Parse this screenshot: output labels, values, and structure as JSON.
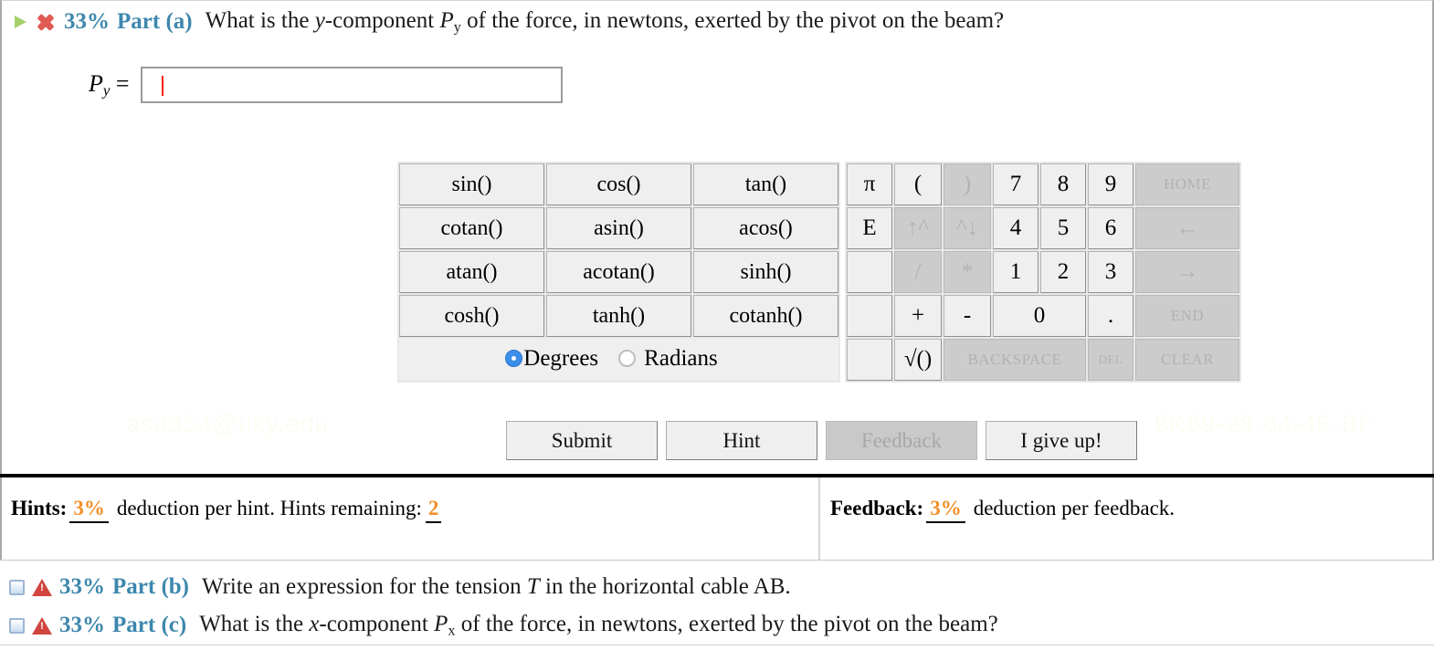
{
  "part_a": {
    "percent": "33%",
    "label": "Part (a)",
    "question_pre": "What is the ",
    "question_var": "y",
    "question_mid": "-component ",
    "question_sym": "P",
    "question_sub": "y",
    "question_post": " of the force, in newtons, exerted by the pivot on the beam?",
    "status_icon": "red-x-icon",
    "expand_icon": "green-triangle-icon"
  },
  "answer": {
    "label_sym": "P",
    "label_sub": "y",
    "label_eq": " = ",
    "value": "",
    "placeholder": ""
  },
  "calculator": {
    "function_rows": [
      [
        "sin()",
        "cos()",
        "tan()"
      ],
      [
        "cotan()",
        "asin()",
        "acos()"
      ],
      [
        "atan()",
        "acotan()",
        "sinh()"
      ],
      [
        "cosh()",
        "tanh()",
        "cotanh()"
      ]
    ],
    "mode": {
      "degrees_label": "Degrees",
      "radians_label": "Radians",
      "selected": "Degrees"
    },
    "keypad_rows": [
      [
        {
          "label": "π",
          "state": "enabled",
          "style": "pi"
        },
        {
          "label": "(",
          "state": "enabled",
          "style": "op"
        },
        {
          "label": ")",
          "state": "disabled",
          "style": "op"
        },
        {
          "label": "7",
          "state": "enabled",
          "style": "num"
        },
        {
          "label": "8",
          "state": "enabled",
          "style": "num"
        },
        {
          "label": "9",
          "state": "enabled",
          "style": "num"
        },
        {
          "label": "HOME",
          "state": "disabled",
          "style": "side-caps"
        }
      ],
      [
        {
          "label": "E",
          "state": "enabled",
          "style": "pi"
        },
        {
          "label": "↑^",
          "state": "disabled",
          "style": "op-arrow"
        },
        {
          "label": "^↓",
          "state": "disabled",
          "style": "op-arrow"
        },
        {
          "label": "4",
          "state": "enabled",
          "style": "num"
        },
        {
          "label": "5",
          "state": "enabled",
          "style": "num"
        },
        {
          "label": "6",
          "state": "enabled",
          "style": "num"
        },
        {
          "label": "←",
          "state": "disabled",
          "style": "side-arrow"
        }
      ],
      [
        {
          "label": "",
          "state": "blank",
          "style": "pi"
        },
        {
          "label": "/",
          "state": "disabled",
          "style": "op"
        },
        {
          "label": "*",
          "state": "disabled",
          "style": "op"
        },
        {
          "label": "1",
          "state": "enabled",
          "style": "num"
        },
        {
          "label": "2",
          "state": "enabled",
          "style": "num"
        },
        {
          "label": "3",
          "state": "enabled",
          "style": "num"
        },
        {
          "label": "→",
          "state": "disabled",
          "style": "side-arrow"
        }
      ],
      [
        {
          "label": "",
          "state": "blank",
          "style": "pi"
        },
        {
          "label": "+",
          "state": "enabled",
          "style": "op"
        },
        {
          "label": "-",
          "state": "enabled",
          "style": "op"
        },
        {
          "label": "0",
          "state": "enabled",
          "style": "num2"
        },
        {
          "label": ".",
          "state": "enabled",
          "style": "num"
        },
        {
          "label": "END",
          "state": "disabled",
          "style": "side-caps"
        }
      ],
      [
        {
          "label": "",
          "state": "blank",
          "style": "pi"
        },
        {
          "label": "√()",
          "state": "enabled",
          "style": "op"
        },
        {
          "label": "BACKSPACE",
          "state": "disabled",
          "style": "span3-caps"
        },
        {
          "label": "DEL",
          "state": "disabled",
          "style": "tiny-caps"
        },
        {
          "label": "CLEAR",
          "state": "disabled",
          "style": "side-caps"
        }
      ]
    ]
  },
  "actions": {
    "submit": "Submit",
    "hint": "Hint",
    "feedback": "Feedback",
    "feedback_state": "disabled",
    "give_up": "I give up!"
  },
  "deductions": {
    "hints_title": "Hints:",
    "hints_percent": "3%",
    "hints_text": "deduction per hint. Hints remaining:",
    "hints_remaining": "2",
    "feedback_title": "Feedback:",
    "feedback_percent": "3%",
    "feedback_text": "deduction per feedback."
  },
  "other_parts": [
    {
      "percent": "33%",
      "label": "Part (b)",
      "question_pre": "Write an expression for the tension ",
      "question_var": "T",
      "question_mid": " in the horizontal cable AB.",
      "question_sym": "",
      "question_sub": "",
      "question_post": ""
    },
    {
      "percent": "33%",
      "label": "Part (c)",
      "question_pre": "What is the ",
      "question_var": "x",
      "question_mid": "-component ",
      "question_sym": "P",
      "question_sub": "x",
      "question_post": " of the force, in newtons, exerted by the pivot on the beam?"
    }
  ],
  "watermarks": {
    "left": "asa354@uky.edu",
    "right": "9K89-28-64-4F-BF"
  },
  "colors": {
    "part_label": "#3d87ad",
    "deduction_value": "#f29029",
    "caret": "#ff2200",
    "radio_selected": "#3b8eea"
  }
}
